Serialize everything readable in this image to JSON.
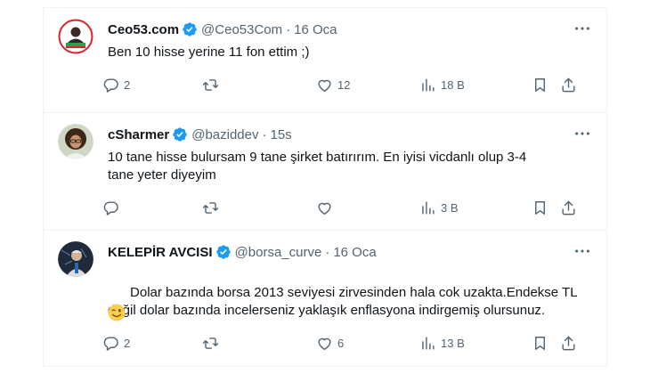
{
  "tweets": [
    {
      "name": "Ceo53.com",
      "handle": "@Ceo53Com",
      "dot": "·",
      "time": "16 Oca",
      "text": "Ben 10 hisse yerine 11 fon ettim ;)",
      "replies": "2",
      "retweets": "",
      "likes": "12",
      "views": "18 B"
    },
    {
      "name": "cSharmer",
      "handle": "@baziddev",
      "dot": "·",
      "time": "15s",
      "text": "10 tane hisse bulursam 9 tane şirket batırırım. En iyisi vicdanlı olup 3-4\ntane yeter diyeyim",
      "replies": "",
      "retweets": "",
      "likes": "",
      "views": "3 B"
    },
    {
      "name": "KELEPİR AVCISI",
      "handle": "@borsa_curve",
      "dot": "·",
      "time": "16 Oca",
      "text": "Dolar bazında borsa 2013 seviyesi zirvesinden hala cok uzakta.Endekse TL\ndeğil dolar bazında incelerseniz yaklaşık enflasyona indirgemiş olursunuz.",
      "replies": "2",
      "retweets": "",
      "likes": "6",
      "views": "13 B"
    }
  ],
  "colors": {
    "verified": "#1d9bf0",
    "text": "#0f1419",
    "secondary": "#536471",
    "border": "#eff3f4"
  },
  "icons": [
    "verified-badge-icon",
    "more-icon",
    "reply-icon",
    "retweet-icon",
    "like-icon",
    "views-icon",
    "bookmark-icon",
    "share-icon",
    "wink-emoji-icon"
  ]
}
